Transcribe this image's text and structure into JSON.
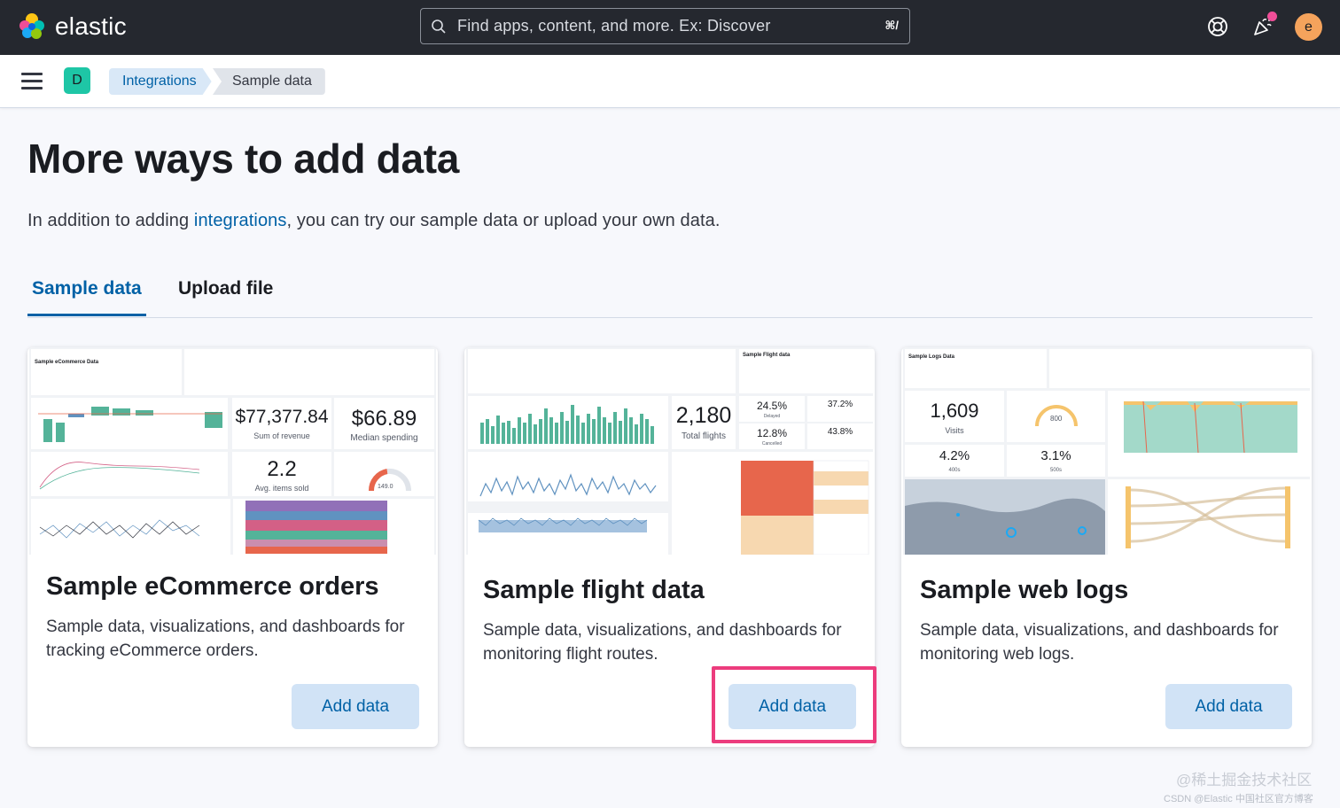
{
  "header": {
    "brand": "elastic",
    "search_placeholder": "Find apps, content, and more. Ex: Discover",
    "search_shortcut": "⌘/",
    "avatar_initial": "e",
    "icons": [
      "elastic-logo-icon",
      "search-icon",
      "help-icon",
      "news-icon"
    ]
  },
  "subbar": {
    "space_initial": "D",
    "breadcrumbs": [
      {
        "label": "Integrations"
      },
      {
        "label": "Sample data"
      }
    ]
  },
  "page": {
    "title": "More ways to add data",
    "intro_prefix": "In addition to adding ",
    "intro_link": "integrations",
    "intro_suffix": ", you can try our sample data or upload your own data.",
    "tabs": [
      {
        "label": "Sample data",
        "active": true
      },
      {
        "label": "Upload file",
        "active": false
      }
    ]
  },
  "cards": [
    {
      "title": "Sample eCommerce orders",
      "description": "Sample data, visualizations, and dashboards for tracking eCommerce orders.",
      "button": "Add data",
      "preview": {
        "panel_title": "Sample eCommerce Data",
        "metrics": [
          {
            "value": "$77,377.84",
            "label": "Sum of revenue"
          },
          {
            "value": "$66.89",
            "label": "Median spending"
          },
          {
            "value": "2.2",
            "label": "Avg. items sold"
          },
          {
            "value": "149.0",
            "label": ""
          }
        ]
      }
    },
    {
      "title": "Sample flight data",
      "description": "Sample data, visualizations, and dashboards for monitoring flight routes.",
      "button": "Add data",
      "highlighted": true,
      "preview": {
        "panel_title": "Sample Flight data",
        "metrics": [
          {
            "value": "2,180",
            "label": "Total flights"
          },
          {
            "value": "24.5%",
            "label": "Delayed"
          },
          {
            "value": "37.2%",
            "label": ""
          },
          {
            "value": "12.8%",
            "label": "Cancelled"
          },
          {
            "value": "43.8%",
            "label": ""
          }
        ]
      }
    },
    {
      "title": "Sample web logs",
      "description": "Sample data, visualizations, and dashboards for monitoring web logs.",
      "button": "Add data",
      "preview": {
        "panel_title": "Sample Logs Data",
        "metrics": [
          {
            "value": "1,609",
            "label": "Visits"
          },
          {
            "value": "800",
            "label": ""
          },
          {
            "value": "4.2%",
            "label": "400s"
          },
          {
            "value": "3.1%",
            "label": "500s"
          }
        ]
      }
    }
  ],
  "watermark": {
    "line1": "@稀土掘金技术社区",
    "line2": "CSDN @Elastic 中国社区官方博客"
  },
  "colors": {
    "header_bg": "#25282f",
    "primary": "#0061a6",
    "button_bg": "#d1e3f6",
    "highlight_border": "#ec3c7d",
    "space_badge": "#1ec6a6",
    "avatar": "#f5a35c"
  }
}
